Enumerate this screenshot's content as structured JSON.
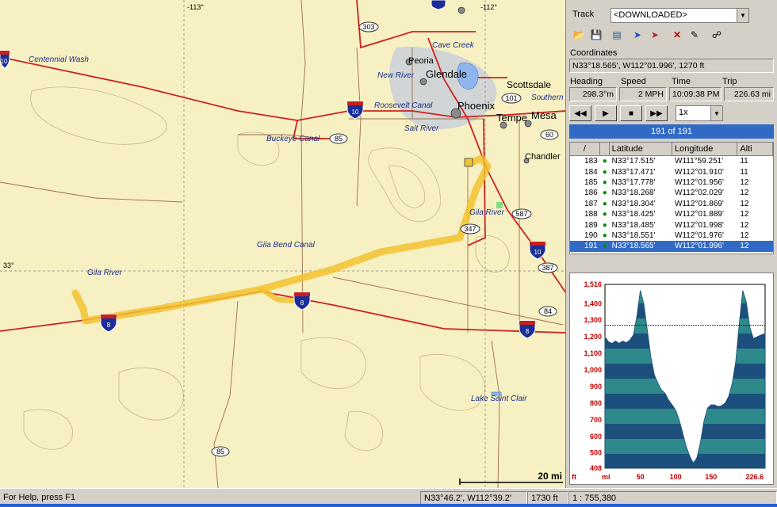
{
  "map": {
    "longitude_labels": [
      "-113°",
      "-112°"
    ],
    "latitude_label": "33°",
    "cities": [
      "Peoria",
      "Glendale",
      "Phoenix",
      "Scottsdale",
      "Tempe",
      "Mesa",
      "Chandler"
    ],
    "water": [
      "Cave Creek",
      "New River",
      "Roosevelt Canal",
      "Salt River",
      "Buckeye Canal",
      "Centennial Wash",
      "Gila Bend Canal",
      "Gila River",
      "Gila River",
      "Southern",
      "Lake Saint Clair"
    ],
    "shields": [
      "10",
      "8",
      "8",
      "8",
      "10",
      "10",
      "303",
      "85",
      "85",
      "101",
      "60",
      "587",
      "347",
      "387",
      "84"
    ],
    "scale": "20 mi",
    "colors": {
      "background": "#f7f0c2",
      "interstate": "#cc2222",
      "track": "#f2c230",
      "urban": "#cdd2d8",
      "water": "#1f2f8a"
    }
  },
  "panel": {
    "track_label": "Track",
    "track_value": "<DOWNLOADED>",
    "toolbar_icons": [
      "open-folder-icon",
      "save-icon",
      "profile-icon",
      "send-icon",
      "receive-icon",
      "delete-icon",
      "edit-icon",
      "binoculars-icon"
    ],
    "coordinates_label": "Coordinates",
    "coordinates_value": "N33°18.565',  W112°01.996',  1270 ft",
    "heading_label": "Heading",
    "speed_label": "Speed",
    "time_label": "Time",
    "trip_label": "Trip",
    "heading_value": "298.3°m",
    "speed_value": "2 MPH",
    "time_value": "10:09:38 PM",
    "trip_value": "226.63 mi",
    "playback_icons": [
      "rewind-icon",
      "play-icon",
      "stop-icon",
      "fast-forward-icon"
    ],
    "playback_speed": "1x",
    "progress_text": "191 of 191",
    "table_headers": [
      "/",
      "Latitude",
      "Longitude",
      "Alti"
    ],
    "table_rows": [
      {
        "id": "183",
        "lat": "N33°17.515'",
        "lon": "W111°59.251'",
        "alt": "11"
      },
      {
        "id": "184",
        "lat": "N33°17.471'",
        "lon": "W112°01.910'",
        "alt": "11"
      },
      {
        "id": "185",
        "lat": "N33°17.778'",
        "lon": "W112°01.956'",
        "alt": "12"
      },
      {
        "id": "186",
        "lat": "N33°18.268'",
        "lon": "W112°02.029'",
        "alt": "12"
      },
      {
        "id": "187",
        "lat": "N33°18.304'",
        "lon": "W112°01.869'",
        "alt": "12"
      },
      {
        "id": "188",
        "lat": "N33°18.425'",
        "lon": "W112°01.889'",
        "alt": "12"
      },
      {
        "id": "189",
        "lat": "N33°18.485'",
        "lon": "W112°01.998'",
        "alt": "12"
      },
      {
        "id": "190",
        "lat": "N33°18.551'",
        "lon": "W112°01.976'",
        "alt": "12"
      },
      {
        "id": "191",
        "lat": "N33°18.565'",
        "lon": "W112°01.996'",
        "alt": "12"
      }
    ],
    "selected_row": "191"
  },
  "chart_data": {
    "type": "area",
    "title": "",
    "ylabel": "ft",
    "xlabel": "mi",
    "y_ticks": [
      "1,516",
      "1,400",
      "1,300",
      "1,200",
      "1,100",
      "1,000",
      "900",
      "800",
      "700",
      "600",
      "500",
      "408"
    ],
    "x_ticks": [
      "50",
      "100",
      "150",
      "226.6"
    ],
    "ylim": [
      408,
      1516
    ],
    "xlim": [
      0,
      226.6
    ],
    "reference_line": 1270,
    "x": [
      0,
      5,
      10,
      15,
      20,
      25,
      30,
      35,
      40,
      45,
      50,
      55,
      60,
      65,
      70,
      75,
      80,
      85,
      90,
      95,
      100,
      105,
      110,
      115,
      120,
      125,
      130,
      135,
      140,
      145,
      150,
      155,
      160,
      165,
      170,
      175,
      180,
      185,
      190,
      195,
      200,
      205,
      210,
      215,
      220,
      226.6
    ],
    "y": [
      1200,
      1170,
      1160,
      1175,
      1160,
      1175,
      1165,
      1180,
      1210,
      1320,
      1480,
      1400,
      1240,
      1080,
      970,
      920,
      880,
      860,
      820,
      790,
      760,
      700,
      620,
      540,
      480,
      440,
      470,
      560,
      690,
      770,
      790,
      790,
      780,
      785,
      800,
      840,
      920,
      1050,
      1280,
      1480,
      1410,
      1260,
      1190,
      1200,
      1210,
      1220
    ]
  },
  "status": {
    "help": "For Help, press F1",
    "cursor": "N33°46.2', W112°39.2'",
    "elevation": "1730 ft",
    "scale": "1 : 755,380"
  }
}
